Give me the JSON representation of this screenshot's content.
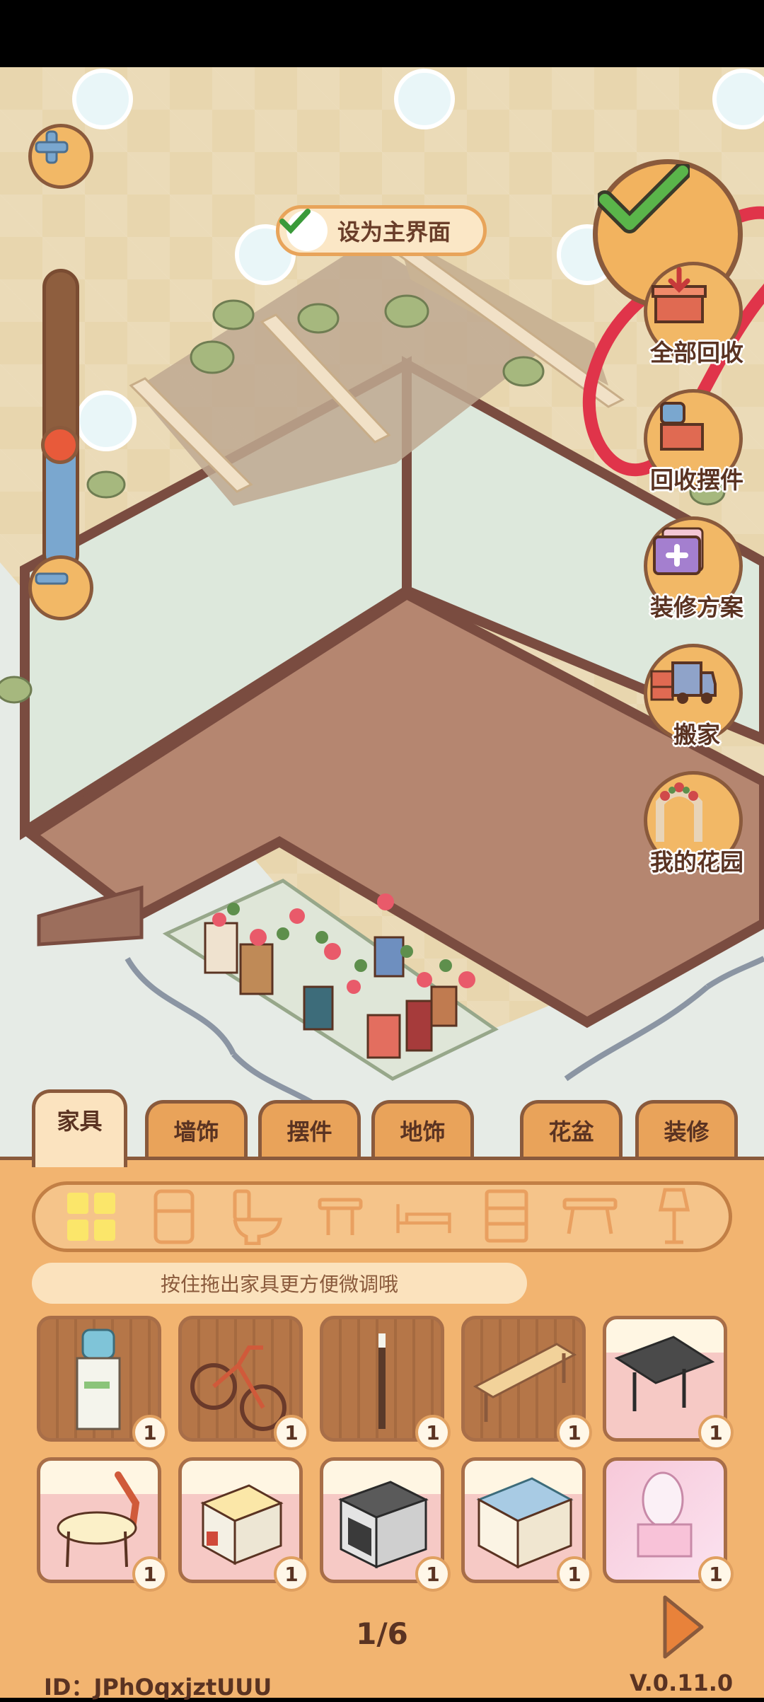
{
  "toolbar": {
    "set_main_label": "设为主界面",
    "zoom_level_fraction": 0.42
  },
  "actions": [
    {
      "label": "全部回收",
      "icon": "box-recycle-icon"
    },
    {
      "label": "回收摆件",
      "icon": "kettle-box-icon"
    },
    {
      "label": "装修方案",
      "icon": "plan-folder-icon"
    },
    {
      "label": "搬家",
      "icon": "moving-truck-icon"
    },
    {
      "label": "我的花园",
      "icon": "garden-arch-icon"
    }
  ],
  "tabs": [
    {
      "label": "家具",
      "active": true
    },
    {
      "label": "墙饰",
      "active": false
    },
    {
      "label": "摆件",
      "active": false
    },
    {
      "label": "地饰",
      "active": false
    },
    {
      "label": "花盆",
      "active": false
    },
    {
      "label": "装修",
      "active": false
    }
  ],
  "categories": [
    "grid-all-icon",
    "fridge-icon",
    "toilet-icon",
    "stool-icon",
    "bed-icon",
    "cabinet-icon",
    "table-icon",
    "lamp-icon"
  ],
  "hint": "按住拖出家具更方便微调哦",
  "items": [
    {
      "name": "water-dispenser",
      "count": "1"
    },
    {
      "name": "bicycle",
      "count": "1"
    },
    {
      "name": "pole",
      "count": "1"
    },
    {
      "name": "bench",
      "count": "1"
    },
    {
      "name": "grill",
      "count": "1"
    },
    {
      "name": "chair",
      "count": "1"
    },
    {
      "name": "cube-seat",
      "count": "1"
    },
    {
      "name": "oven",
      "count": "1"
    },
    {
      "name": "sink",
      "count": "1"
    },
    {
      "name": "vanity",
      "count": "1"
    }
  ],
  "pager": "1/6",
  "user_id": "ID：JPhOqxjztUUU",
  "version": "V.0.11.0",
  "colors": {
    "accent": "#f2b470",
    "border": "#8a5a3c",
    "text": "#5a3322",
    "annotation": "#e0344a"
  }
}
